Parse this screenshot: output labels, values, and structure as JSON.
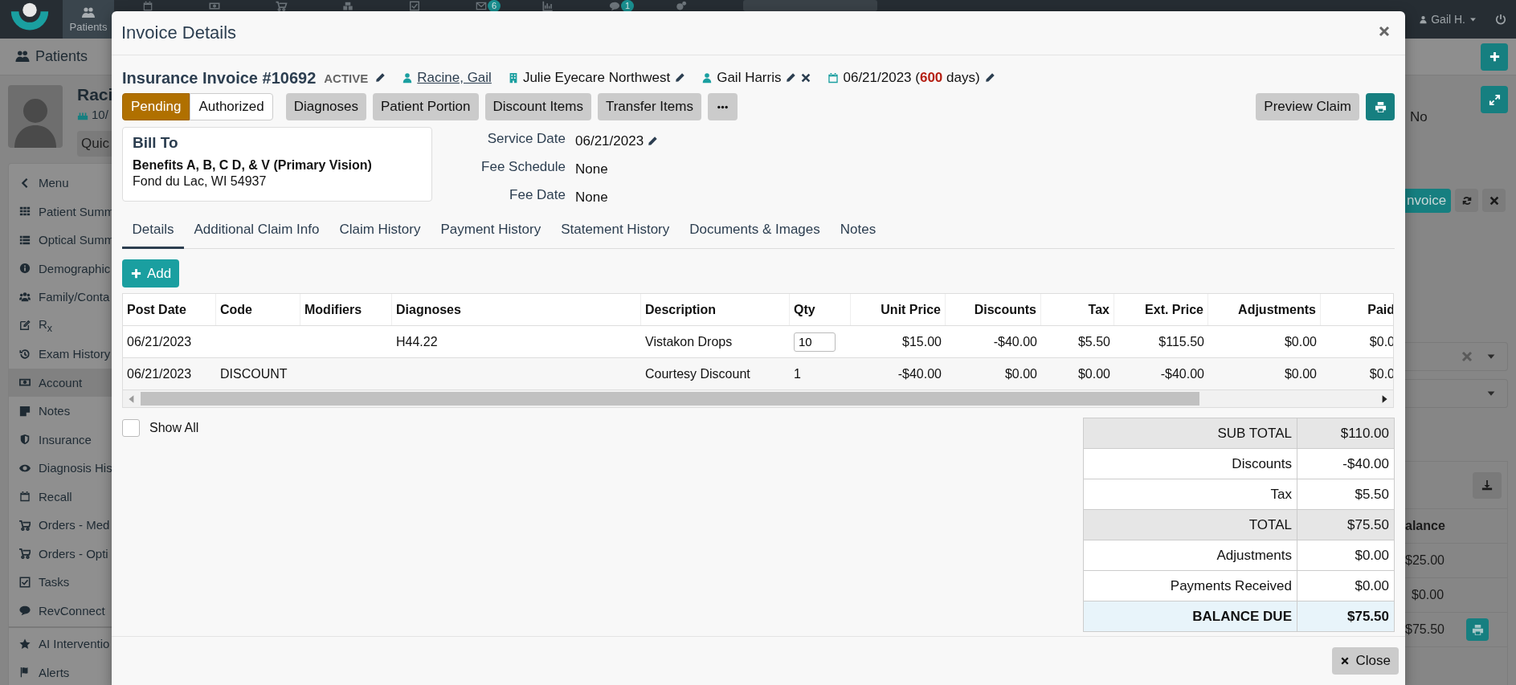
{
  "top_nav": {
    "items": [
      {
        "label": "Patients",
        "selected": true
      }
    ],
    "mail_badge": "6",
    "chat_badge": "1",
    "user": "Gail H."
  },
  "background": {
    "tabs": [
      {
        "label": "Patients"
      }
    ],
    "patient": {
      "name": "Raci",
      "dob": "10/",
      "quick_button": "Quic"
    },
    "menu": [
      {
        "label": "Menu",
        "kind": "back",
        "selected": false
      },
      {
        "label": "Patient Summ",
        "kind": "grid",
        "selected": false
      },
      {
        "label": "Optical Summ",
        "kind": "list",
        "selected": false
      },
      {
        "label": "Demographic",
        "kind": "info",
        "selected": false
      },
      {
        "label": "Family/Conta",
        "kind": "people",
        "selected": false
      },
      {
        "label": "R$_{x}$",
        "kind": "edit",
        "selected": false
      },
      {
        "label": "Exam History",
        "kind": "history",
        "selected": false
      },
      {
        "label": "Account",
        "kind": "money",
        "selected": true
      },
      {
        "label": "Notes",
        "kind": "note",
        "selected": false
      },
      {
        "label": "Insurance",
        "kind": "shield",
        "selected": false
      },
      {
        "label": "Diagnosis His",
        "kind": "eye",
        "selected": false
      },
      {
        "label": "Recall",
        "kind": "calendar",
        "selected": false
      },
      {
        "label": "Orders - Med",
        "kind": "cart",
        "selected": false
      },
      {
        "label": "Orders - Opti",
        "kind": "cart",
        "selected": false
      },
      {
        "label": "Tasks",
        "kind": "check",
        "selected": false
      },
      {
        "label": "RevConnect",
        "kind": "chat",
        "selected": false
      }
    ],
    "menu_extra": [
      {
        "label": "AI Interventio",
        "kind": "star",
        "selected": false
      },
      {
        "label": "Alerts",
        "kind": "flag",
        "selected": false
      }
    ],
    "right": {
      "flag": "No",
      "invoice_button": "nvoice",
      "balance_header": "alance",
      "balances": [
        "$25.00",
        "$0.00",
        "$75.50"
      ]
    }
  },
  "modal": {
    "title": "Invoice Details",
    "invoice": {
      "title": "Insurance Invoice #10692",
      "status": "ACTIVE",
      "patient": "Racine, Gail",
      "location": "Julie Eyecare Northwest",
      "provider": "Gail Harris",
      "date": "06/21/2023 (**600** days)"
    },
    "approval": [
      {
        "label": "Pending",
        "selected": true
      },
      {
        "label": "Authorized",
        "selected": false
      }
    ],
    "actions": [
      "Diagnoses",
      "Patient Portion",
      "Discount Items",
      "Transfer Items"
    ],
    "preview_button": "Preview Claim",
    "bill_to": {
      "heading": "Bill To",
      "name": "Benefits A, B, C D, & V (Primary Vision)",
      "address": "Fond du Lac, WI 54937"
    },
    "fields": [
      {
        "label": "Service Date",
        "value": "06/21/2023",
        "editable": true
      },
      {
        "label": "Fee Schedule",
        "value": "None",
        "editable": false
      },
      {
        "label": "Fee Date",
        "value": "None",
        "editable": false
      }
    ],
    "tabs": [
      {
        "label": "Details",
        "selected": true
      },
      {
        "label": "Additional Claim Info",
        "selected": false
      },
      {
        "label": "Claim History",
        "selected": false
      },
      {
        "label": "Payment History",
        "selected": false
      },
      {
        "label": "Statement History",
        "selected": false
      },
      {
        "label": "Documents & Images",
        "selected": false
      },
      {
        "label": "Notes",
        "selected": false
      }
    ],
    "add_button": "Add",
    "table": {
      "columns": [
        "Post Date",
        "Code",
        "Modifiers",
        "Diagnoses",
        "Description",
        "Qty",
        "Unit Price",
        "Discounts",
        "Tax",
        "Ext. Price",
        "Adjustments",
        "Paid"
      ],
      "rows": [
        {
          "qty_editable": true,
          "cells": [
            "06/21/2023",
            null,
            null,
            "H44.22",
            "Vistakon Drops",
            "10",
            "$15.00",
            "-$40.00",
            "$5.50",
            "$115.50",
            "$0.00",
            "$0.0"
          ]
        },
        {
          "qty_editable": false,
          "cells": [
            "06/21/2023",
            "DISCOUNT",
            null,
            null,
            "Courtesy Discount",
            "1",
            "-$40.00",
            "$0.00",
            "$0.00",
            "-$40.00",
            "$0.00",
            "$0.0"
          ]
        }
      ]
    },
    "show_all": {
      "label": "Show All",
      "checked": false
    },
    "totals": [
      {
        "label": "SUB TOTAL",
        "value": "$110.00",
        "kind": "subtotal"
      },
      {
        "label": "Discounts",
        "value": "-$40.00",
        "kind": "line"
      },
      {
        "label": "Tax",
        "value": "$5.50",
        "kind": "line"
      },
      {
        "label": "TOTAL",
        "value": "$75.50",
        "kind": "subtotal"
      },
      {
        "label": "Adjustments",
        "value": "$0.00",
        "kind": "line"
      },
      {
        "label": "Payments Received",
        "value": "$0.00",
        "kind": "line"
      },
      {
        "label": "BALANCE DUE",
        "value": "$75.50",
        "kind": "balance"
      }
    ],
    "close_button": "Close"
  }
}
